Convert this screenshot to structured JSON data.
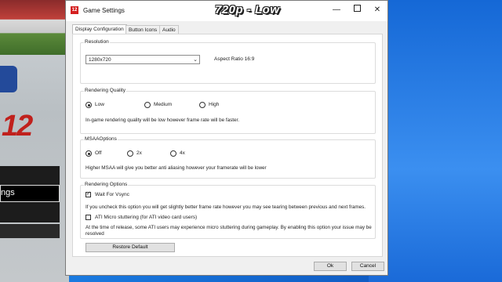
{
  "window": {
    "title": "Game Settings",
    "app_icon_text": "12",
    "overlay_title": "720p - Low",
    "minimize_glyph": "—",
    "close_glyph": "✕"
  },
  "tabs": [
    {
      "label": "Display Configuration",
      "active": true
    },
    {
      "label": "Button Icons",
      "active": false
    },
    {
      "label": "Audio",
      "active": false
    }
  ],
  "resolution": {
    "group_label": "Resolution",
    "selected": "1280x720",
    "aspect_ratio": "Aspect Ratio 16:9"
  },
  "rendering_quality": {
    "group_label": "Rendering Quality",
    "options": [
      "Low",
      "Medium",
      "High"
    ],
    "selected": "Low",
    "description": "In-game rendering quality will be low however frame rate will be faster."
  },
  "msaa": {
    "group_label": "MSAAOptions",
    "options": [
      "Off",
      "2x",
      "4x"
    ],
    "selected": "Off",
    "description": "Higher MSAA will give you better anti aliasing however your framerate will be lower"
  },
  "rendering_options": {
    "group_label": "Rendering Options",
    "vsync_label": "Wait For Vsync",
    "vsync_checked": true,
    "vsync_description": "If you uncheck this option you will get slightly better frame rate however you may see tearing between previous and next frames.",
    "ati_label": "ATI Micro stuttering (for ATI video card users)",
    "ati_checked": false,
    "ati_description_line1": "At the time of release, some ATI users may experience micro stuttering during gameplay. By enabling this option your issue may be",
    "ati_description_line2": "resolved"
  },
  "buttons": {
    "restore": "Restore Default",
    "ok": "Ok",
    "cancel": "Cancel"
  },
  "background_game": {
    "menu_selected": "ngs",
    "logo_number": "12"
  }
}
